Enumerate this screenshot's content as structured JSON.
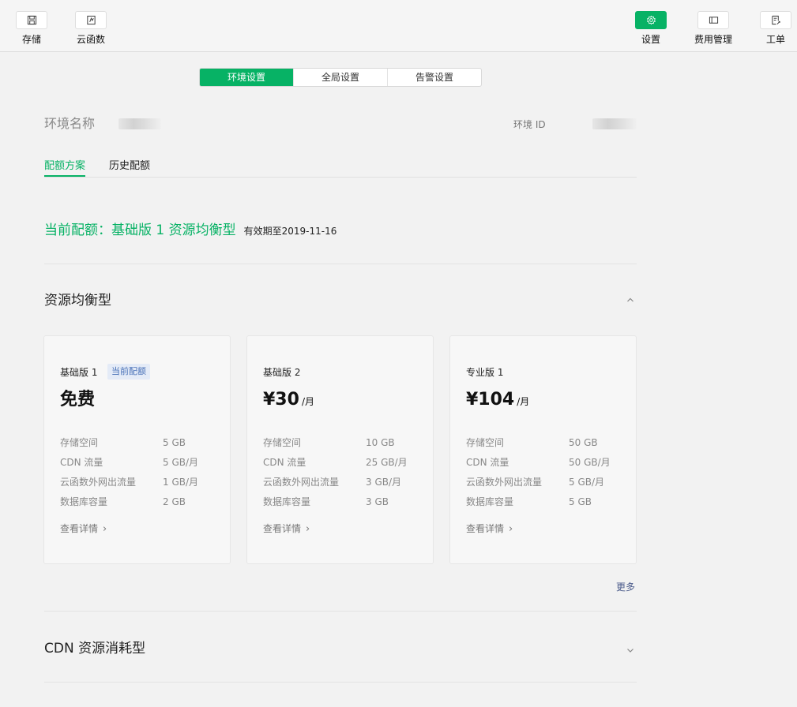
{
  "toolbar": {
    "left": [
      {
        "label": "存储",
        "icon": "save-icon"
      },
      {
        "label": "云函数",
        "icon": "cloud-function-icon"
      }
    ],
    "right": [
      {
        "label": "设置",
        "icon": "gear-icon",
        "active": true
      },
      {
        "label": "费用管理",
        "icon": "billing-icon"
      },
      {
        "label": "工单",
        "icon": "ticket-icon"
      }
    ]
  },
  "segment_tabs": [
    {
      "label": "环境设置",
      "active": true
    },
    {
      "label": "全局设置"
    },
    {
      "label": "告警设置"
    }
  ],
  "env": {
    "name_label": "环境名称",
    "id_label": "环境 ID"
  },
  "sub_tabs": [
    {
      "label": "配额方案",
      "active": true
    },
    {
      "label": "历史配额"
    }
  ],
  "current_quota": {
    "title": "当前配额：基础版 1 资源均衡型",
    "expiry": "有效期至2019-11-16"
  },
  "section_balanced": {
    "title": "资源均衡型",
    "expanded": true
  },
  "plans": [
    {
      "name": "基础版 1",
      "badge": "当前配额",
      "price": "免费",
      "unit": "",
      "specs": [
        {
          "label": "存储空间",
          "value": "5 GB"
        },
        {
          "label": "CDN 流量",
          "value": "5 GB/月"
        },
        {
          "label": "云函数外网出流量",
          "value": "1 GB/月"
        },
        {
          "label": "数据库容量",
          "value": "2 GB"
        }
      ],
      "detail": "查看详情"
    },
    {
      "name": "基础版 2",
      "badge": "",
      "price": "¥30",
      "unit": "/月",
      "specs": [
        {
          "label": "存储空间",
          "value": "10 GB"
        },
        {
          "label": "CDN 流量",
          "value": "25 GB/月"
        },
        {
          "label": "云函数外网出流量",
          "value": "3 GB/月"
        },
        {
          "label": "数据库容量",
          "value": "3 GB"
        }
      ],
      "detail": "查看详情"
    },
    {
      "name": "专业版 1",
      "badge": "",
      "price": "¥104",
      "unit": "/月",
      "specs": [
        {
          "label": "存储空间",
          "value": "50 GB"
        },
        {
          "label": "CDN 流量",
          "value": "50 GB/月"
        },
        {
          "label": "云函数外网出流量",
          "value": "5 GB/月"
        },
        {
          "label": "数据库容量",
          "value": "5 GB"
        }
      ],
      "detail": "查看详情"
    }
  ],
  "more_label": "更多",
  "section_cdn": {
    "title": "CDN 资源消耗型",
    "expanded": false
  },
  "colors": {
    "accent": "#07b265",
    "badge_text": "#4a72b8",
    "badge_bg": "#e4ebf7",
    "link": "#4a5a8a"
  }
}
